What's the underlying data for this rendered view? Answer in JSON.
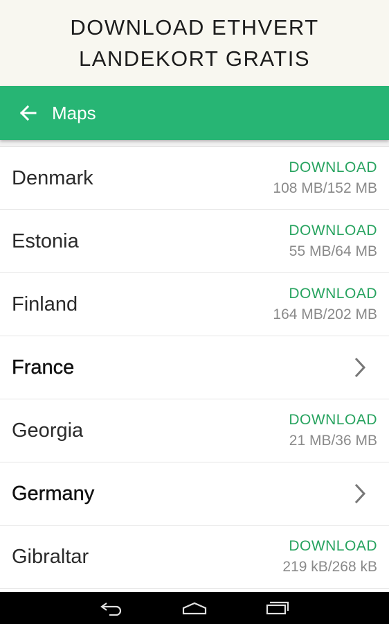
{
  "banner": {
    "line1": "DOWNLOAD ETHVERT",
    "line2": "LANDEKORT GRATIS"
  },
  "appbar": {
    "title": "Maps",
    "back_icon": "arrow-left-icon",
    "color": "#27b574"
  },
  "list": {
    "items": [
      {
        "name": "Denmark",
        "type": "download",
        "action": "DOWNLOAD",
        "size": "108 MB/152 MB"
      },
      {
        "name": "Estonia",
        "type": "download",
        "action": "DOWNLOAD",
        "size": "55 MB/64 MB"
      },
      {
        "name": "Finland",
        "type": "download",
        "action": "DOWNLOAD",
        "size": "164 MB/202 MB"
      },
      {
        "name": "France",
        "type": "folder",
        "icon": "chevron-right-icon"
      },
      {
        "name": "Georgia",
        "type": "download",
        "action": "DOWNLOAD",
        "size": "21 MB/36 MB"
      },
      {
        "name": "Germany",
        "type": "folder",
        "icon": "chevron-right-icon"
      },
      {
        "name": "Gibraltar",
        "type": "download",
        "action": "DOWNLOAD",
        "size": "219 kB/268 kB"
      }
    ],
    "download_color": "#27a35f"
  },
  "navbar": {
    "buttons": [
      "back-icon",
      "home-icon",
      "recent-apps-icon"
    ]
  }
}
